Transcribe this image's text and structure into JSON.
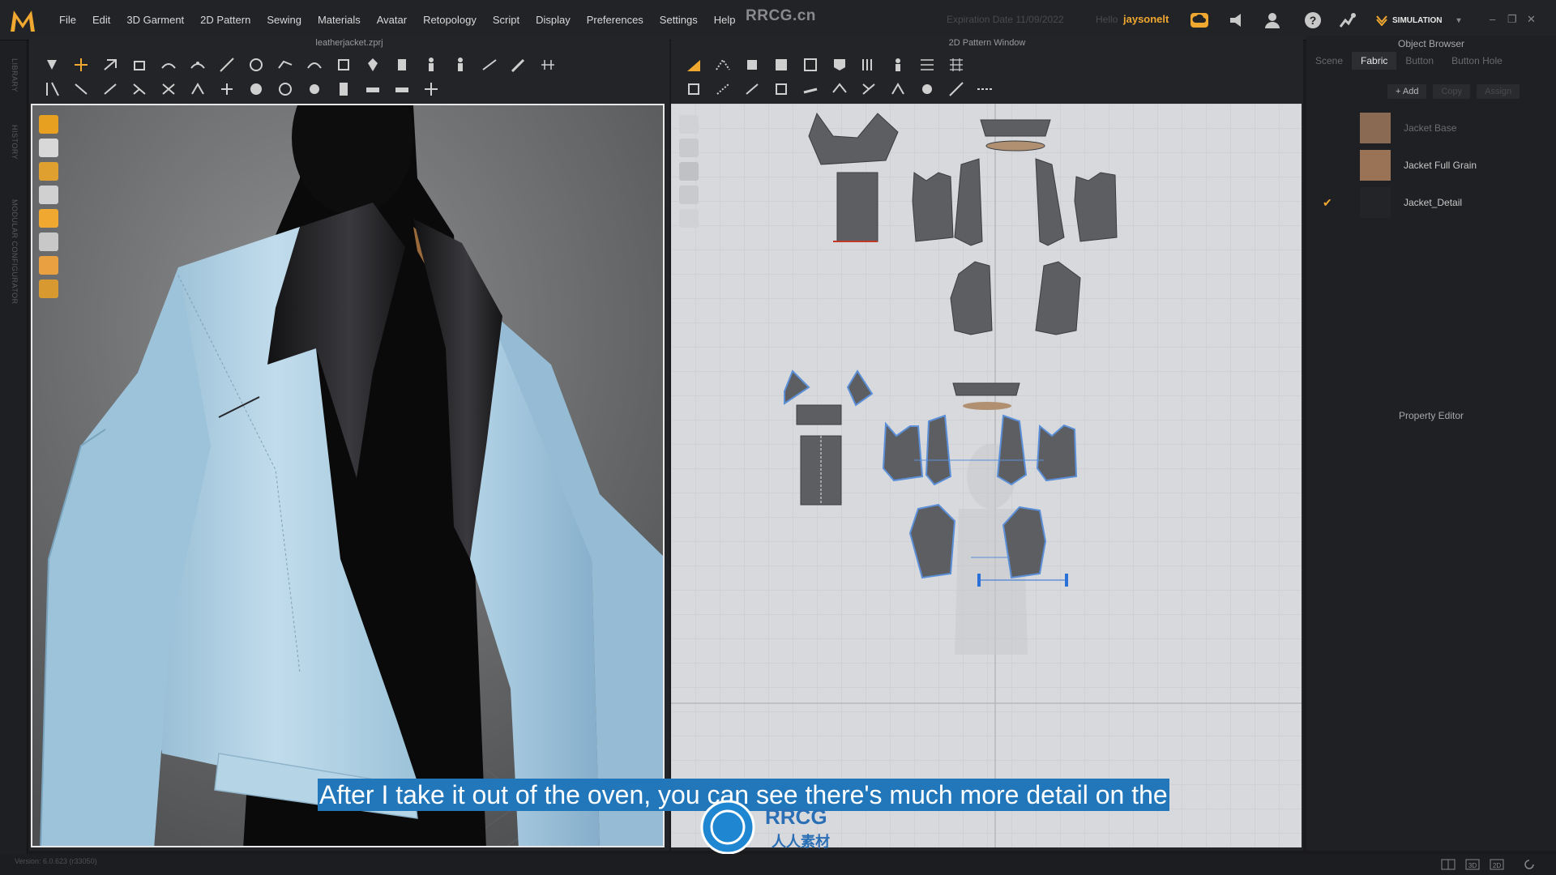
{
  "app": {
    "brand": "RRCG.cn",
    "expiration_label": "Expiration Date 11/09/2022",
    "hello_label": "Hello",
    "username": "jaysonelt",
    "mode": "SIMULATION",
    "menu": [
      "File",
      "Edit",
      "3D Garment",
      "2D Pattern",
      "Sewing",
      "Materials",
      "Avatar",
      "Retopology",
      "Script",
      "Display",
      "Preferences",
      "Settings",
      "Help"
    ]
  },
  "sidebar": {
    "labels": [
      "LIBRARY",
      "HISTORY",
      "MODULAR CONFIGURATOR"
    ]
  },
  "window3d": {
    "title": "leatherjacket.zprj"
  },
  "window2d": {
    "title": "2D Pattern Window"
  },
  "object_browser": {
    "title": "Object Browser",
    "tabs": [
      "Scene",
      "Fabric",
      "Button",
      "Button Hole"
    ],
    "active_tab": "Fabric",
    "actions": {
      "add": "+ Add",
      "copy": "Copy",
      "assign": "Assign"
    },
    "fabrics": [
      {
        "name": "Jacket Base",
        "swatch_color": "#8a6a52",
        "checked": false
      },
      {
        "name": "Jacket Full Grain",
        "swatch_color": "#9a7356",
        "checked": false
      },
      {
        "name": "Jacket_Detail",
        "swatch_color": "#232427",
        "checked": true
      }
    ]
  },
  "property_editor": {
    "title": "Property Editor"
  },
  "subtitle": "After I take it out of the oven, you can see there's much more detail on the",
  "watermark": "RRCG",
  "watermark_sub": "人人素材",
  "status": {
    "version": "Version: 6.0.623 (r33050)"
  },
  "colors": {
    "accent": "#f0a830",
    "jacket": "#a9cde3",
    "pattern_piece": "#5a5c60",
    "subtitle_bg": "#2277bb"
  }
}
